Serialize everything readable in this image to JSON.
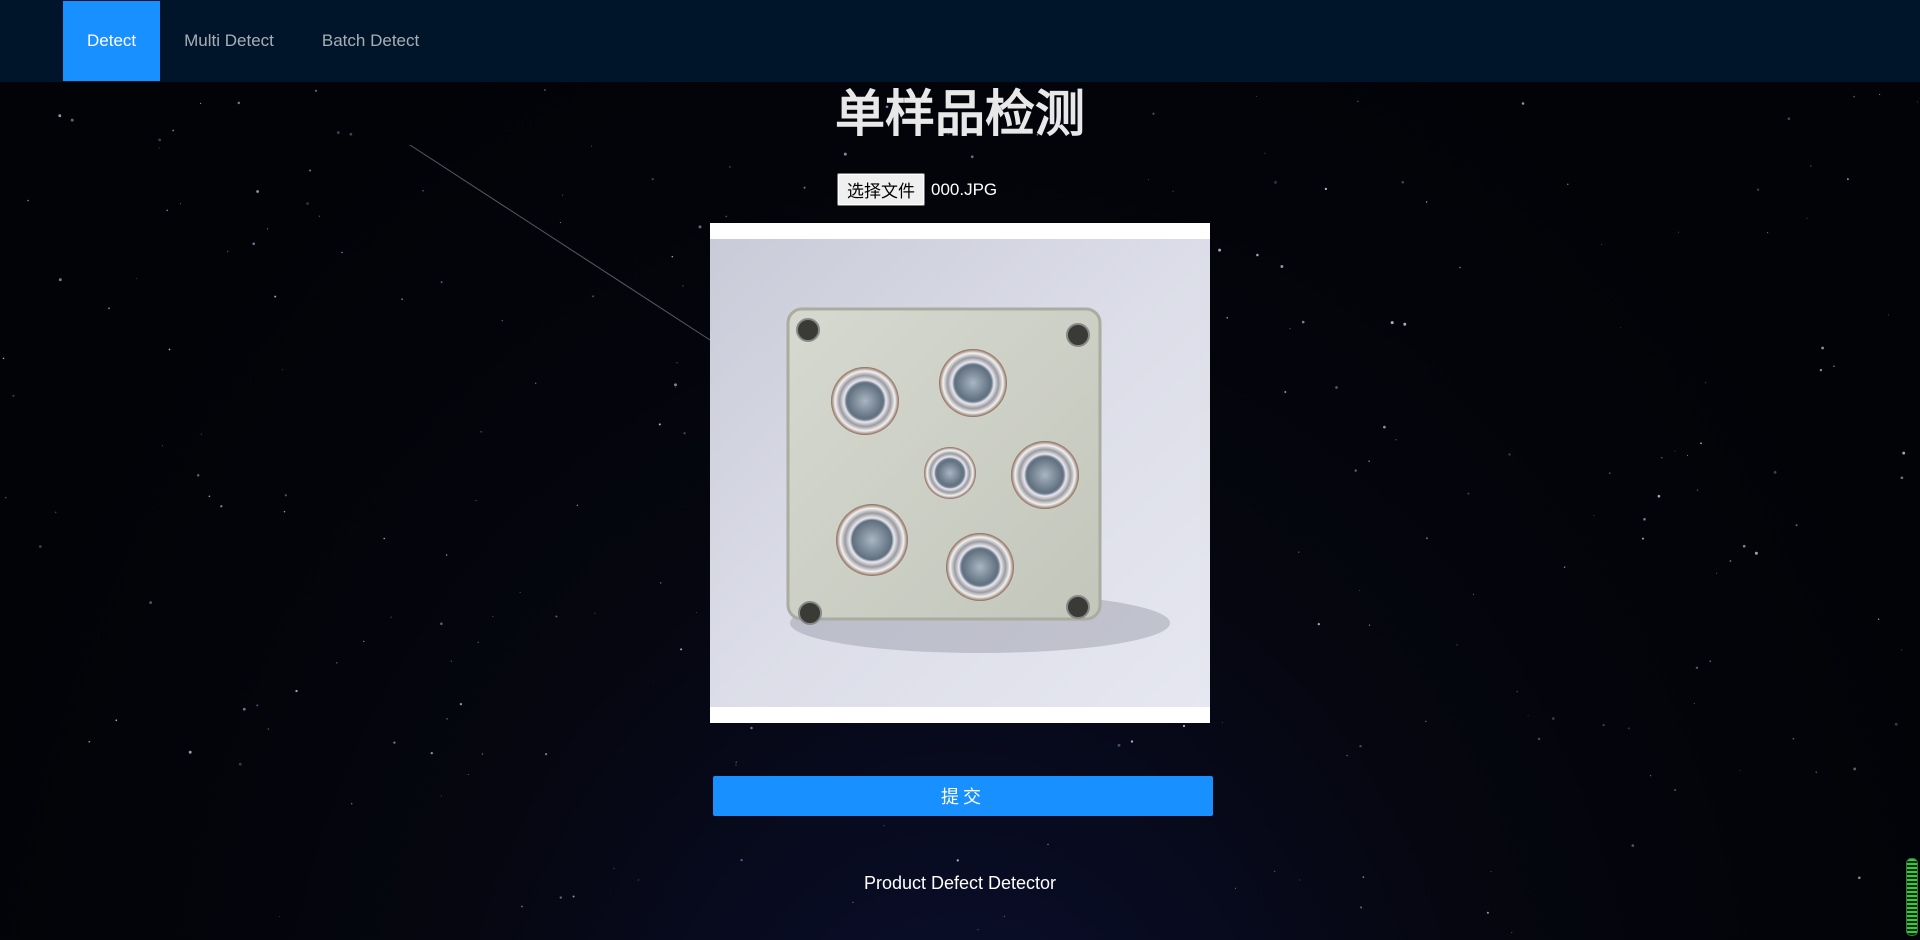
{
  "nav": {
    "items": [
      {
        "label": "Detect",
        "active": true
      },
      {
        "label": "Multi Detect",
        "active": false
      },
      {
        "label": "Batch Detect",
        "active": false
      }
    ]
  },
  "page": {
    "title": "单样品检测"
  },
  "upload": {
    "button_label": "选择文件",
    "file_name": "000.JPG"
  },
  "preview": {
    "subject": "control box with six push buttons"
  },
  "actions": {
    "submit_label": "提交"
  },
  "footer": {
    "text": "Product Defect Detector"
  },
  "colors": {
    "nav_bg": "#001529",
    "accent": "#1890ff",
    "background": "#020307"
  }
}
